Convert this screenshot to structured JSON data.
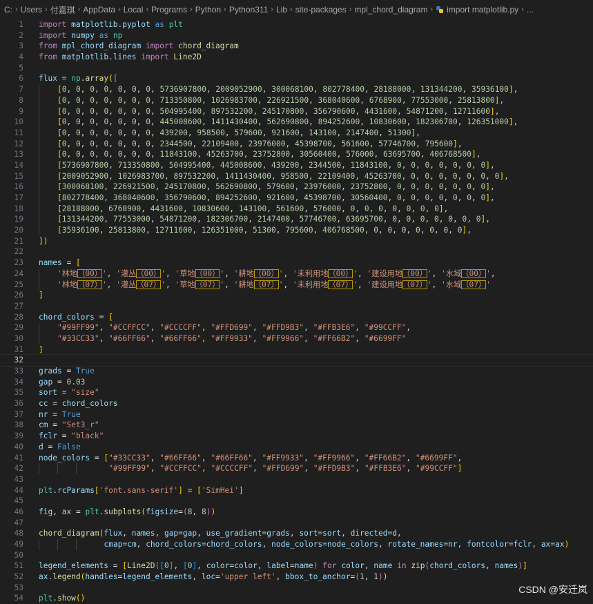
{
  "breadcrumb": {
    "items": [
      "C:",
      "Users",
      "付嘉琪",
      "AppData",
      "Local",
      "Programs",
      "Python",
      "Python311",
      "Lib",
      "site-packages",
      "mpl_chord_diagram"
    ],
    "file": "import matplotlib.py",
    "ellipsis": "..."
  },
  "editor": {
    "active_line": 32,
    "lines": [
      "import matplotlib.pyplot as plt",
      "import numpy as np",
      "from mpl_chord_diagram import chord_diagram",
      "from matplotlib.lines import Line2D",
      "",
      "flux = np.array([",
      "    [0, 0, 0, 0, 0, 0, 0, 5736907800, 2009052900, 300068100, 802778400, 28188000, 131344200, 35936100],",
      "    [0, 0, 0, 0, 0, 0, 0, 713350800, 1026983700, 226921500, 368040600, 6768900, 77553000, 25813800],",
      "    [0, 0, 0, 0, 0, 0, 0, 504995400, 897532200, 245170800, 356790600, 4431600, 54871200, 12711600],",
      "    [0, 0, 0, 0, 0, 0, 0, 445008600, 1411430400, 562690800, 894252600, 10830600, 182306700, 126351000],",
      "    [0, 0, 0, 0, 0, 0, 0, 439200, 958500, 579600, 921600, 143100, 2147400, 51300],",
      "    [0, 0, 0, 0, 0, 0, 0, 2344500, 22109400, 23976000, 45398700, 561600, 57746700, 795600],",
      "    [0, 0, 0, 0, 0, 0, 0, 11843100, 45263700, 23752800, 30560400, 576000, 63695700, 406768500],",
      "    [5736907800, 713350800, 504995400, 445008600, 439200, 2344500, 11843100, 0, 0, 0, 0, 0, 0, 0],",
      "    [2009052900, 1026983700, 897532200, 1411430400, 958500, 22109400, 45263700, 0, 0, 0, 0, 0, 0, 0],",
      "    [300068100, 226921500, 245170800, 562690800, 579600, 23976000, 23752800, 0, 0, 0, 0, 0, 0, 0],",
      "    [802778400, 368040600, 356790600, 894252600, 921600, 45398700, 30560400, 0, 0, 0, 0, 0, 0, 0],",
      "    [28188000, 6768900, 4431600, 10830600, 143100, 561600, 576000, 0, 0, 0, 0, 0, 0, 0],",
      "    [131344200, 77553000, 54871200, 182306700, 2147400, 57746700, 63695700, 0, 0, 0, 0, 0, 0, 0],",
      "    [35936100, 25813800, 12711600, 126351000, 51300, 795600, 406768500, 0, 0, 0, 0, 0, 0, 0],",
      "])",
      "",
      "names = [",
      "    '林地（00）', '灌丛（00）', '草地（00）', '耕地（00）', '未利用地（00）', '建设用地（00）', '水域（00）',",
      "    '林地（07）', '灌丛（07）', '草地（07）', '耕地（07）', '未利用地（07）', '建设用地（07）', '水域（07）'",
      "]",
      "",
      "chord_colors = [",
      "    \"#99FF99\", \"#CCFFCC\", \"#CCCCFF\", \"#FFD699\", \"#FFD9B3\", \"#FFB3E6\", \"#99CCFF\",",
      "    \"#33CC33\", \"#66FF66\", \"#66FF66\", \"#FF9933\", \"#FF9966\", \"#FF66B2\", \"#6699FF\"",
      "]",
      "",
      "grads = True",
      "gap = 0.03",
      "sort = \"size\"",
      "cc = chord_colors",
      "nr = True",
      "cm = \"Set3_r\"",
      "fclr = \"black\"",
      "d = False",
      "node_colors = [\"#33CC33\", \"#66FF66\", \"#66FF66\", \"#FF9933\", \"#FF9966\", \"#FF66B2\", \"#6699FF\",",
      "               \"#99FF99\", \"#CCFFCC\", \"#CCCCFF\", \"#FFD699\", \"#FFD9B3\", \"#FFB3E6\", \"#99CCFF\"]",
      "",
      "plt.rcParams['font.sans-serif'] = ['SimHei']",
      "",
      "fig, ax = plt.subplots(figsize=(8, 8))",
      "",
      "chord_diagram(flux, names, gap=gap, use_gradient=grads, sort=sort, directed=d,",
      "              cmap=cm, chord_colors=chord_colors, node_colors=node_colors, rotate_names=nr, fontcolor=fclr, ax=ax)",
      "",
      "legend_elements = [Line2D([0], [0], color=color, label=name) for color, name in zip(chord_colors, names)]",
      "ax.legend(handles=legend_elements, loc='upper left', bbox_to_anchor=(1, 1))",
      "",
      "plt.show()"
    ]
  },
  "watermark": "CSDN @安迁岚"
}
